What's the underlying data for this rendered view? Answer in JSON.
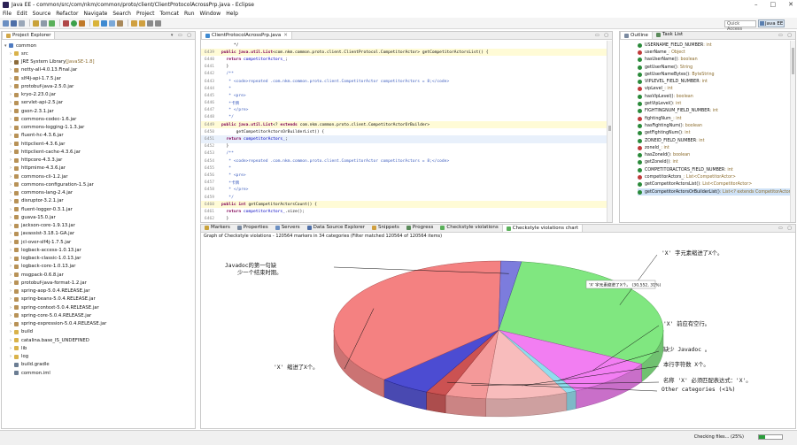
{
  "window": {
    "title": "Java EE - common/src/com/nkm/common/proto/client/ClientProtocolAcrossPrp.java - Eclipse",
    "controls": [
      "–",
      "□",
      "✕"
    ]
  },
  "menu": [
    "File",
    "Edit",
    "Source",
    "Refactor",
    "Navigate",
    "Search",
    "Project",
    "Tomcat",
    "Run",
    "Window",
    "Help"
  ],
  "toolbar": {
    "quick_access_placeholder": "Quick Access",
    "perspective": "Java EE"
  },
  "project_explorer": {
    "tab_label": "Project Explorer",
    "root": "common",
    "items": [
      {
        "label": "src",
        "kind": "folder"
      },
      {
        "label": "JRE System Library",
        "suffix": " [JavaSE-1.8]",
        "kind": "lib"
      },
      {
        "label": "netty-all-4.0.13.Final.jar",
        "kind": "jar"
      },
      {
        "label": "slf4j-api-1.7.5.jar",
        "kind": "jar"
      },
      {
        "label": "protobuf-java-2.5.0.jar",
        "kind": "jar"
      },
      {
        "label": "kryo-2.23.0.jar",
        "kind": "jar"
      },
      {
        "label": "servlet-api-2.5.jar",
        "kind": "jar"
      },
      {
        "label": "gson-2.3.1.jar",
        "kind": "jar"
      },
      {
        "label": "commons-codec-1.6.jar",
        "kind": "jar"
      },
      {
        "label": "commons-logging-1.1.3.jar",
        "kind": "jar"
      },
      {
        "label": "fluent-hc-4.3.6.jar",
        "kind": "jar"
      },
      {
        "label": "httpclient-4.3.6.jar",
        "kind": "jar"
      },
      {
        "label": "httpclient-cache-4.3.6.jar",
        "kind": "jar"
      },
      {
        "label": "httpcore-4.3.3.jar",
        "kind": "jar"
      },
      {
        "label": "httpmime-4.3.6.jar",
        "kind": "jar"
      },
      {
        "label": "commons-cli-1.2.jar",
        "kind": "jar"
      },
      {
        "label": "commons-configuration-1.5.jar",
        "kind": "jar"
      },
      {
        "label": "commons-lang-2.4.jar",
        "kind": "jar"
      },
      {
        "label": "disruptor-3.2.1.jar",
        "kind": "jar"
      },
      {
        "label": "fluent-logger-0.3.1.jar",
        "kind": "jar"
      },
      {
        "label": "guava-15.0.jar",
        "kind": "jar"
      },
      {
        "label": "jackson-core-1.9.13.jar",
        "kind": "jar"
      },
      {
        "label": "javassist-3.18.1-GA.jar",
        "kind": "jar"
      },
      {
        "label": "jcl-over-slf4j-1.7.5.jar",
        "kind": "jar"
      },
      {
        "label": "logback-access-1.0.13.jar",
        "kind": "jar"
      },
      {
        "label": "logback-classic-1.0.13.jar",
        "kind": "jar"
      },
      {
        "label": "logback-core-1.0.13.jar",
        "kind": "jar"
      },
      {
        "label": "msgpack-0.6.8.jar",
        "kind": "jar"
      },
      {
        "label": "protobuf-java-format-1.2.jar",
        "kind": "jar"
      },
      {
        "label": "spring-aop-5.0.4.RELEASE.jar",
        "kind": "jar"
      },
      {
        "label": "spring-beans-5.0.4.RELEASE.jar",
        "kind": "jar"
      },
      {
        "label": "spring-context-5.0.4.RELEASE.jar",
        "kind": "jar"
      },
      {
        "label": "spring-core-5.0.4.RELEASE.jar",
        "kind": "jar"
      },
      {
        "label": "spring-expression-5.0.4.RELEASE.jar",
        "kind": "jar"
      },
      {
        "label": "build",
        "kind": "folder"
      },
      {
        "label": "catalina.base_IS_UNDEFINED",
        "kind": "folder"
      },
      {
        "label": "lib",
        "kind": "folder"
      },
      {
        "label": "log",
        "kind": "folder"
      },
      {
        "label": "build.gradle",
        "kind": "file"
      },
      {
        "label": "common.iml",
        "kind": "file"
      }
    ]
  },
  "editor": {
    "tab_label": "ClientProtocolAcrossPrp.java",
    "lines": [
      {
        "n": "",
        "parts": [
          [
            "",
            "     */"
          ]
        ]
      },
      {
        "n": "6439",
        "hl": true,
        "parts": [
          [
            "kw",
            "public "
          ],
          [
            "kw",
            "java.util.List"
          ],
          [
            "",
            "<com.nkm.common.proto.client.ClientProtocol.CompetitorActor> getCompetitorActorsList() {"
          ]
        ]
      },
      {
        "n": "6440",
        "parts": [
          [
            "kw",
            "  return "
          ],
          [
            "fld",
            "competitorActors_"
          ],
          [
            "",
            ";"
          ]
        ]
      },
      {
        "n": "6441",
        "parts": [
          [
            "",
            "  }"
          ]
        ]
      },
      {
        "n": "6442",
        "parts": [
          [
            "cm",
            "  /**"
          ]
        ]
      },
      {
        "n": "6443",
        "parts": [
          [
            "cm",
            "   * <code>repeated .com.nkm.common.proto.client.CompetitorActor competitorActors = 8;</code>"
          ]
        ]
      },
      {
        "n": "6444",
        "parts": [
          [
            "cm",
            "   *"
          ]
        ]
      },
      {
        "n": "6445",
        "parts": [
          [
            "cm",
            "   * <pre>"
          ]
        ]
      },
      {
        "n": "6446",
        "parts": [
          [
            "cm",
            "   *卡牌"
          ]
        ]
      },
      {
        "n": "6447",
        "parts": [
          [
            "cm",
            "   * </pre>"
          ]
        ]
      },
      {
        "n": "6448",
        "parts": [
          [
            "cm",
            "   */"
          ]
        ]
      },
      {
        "n": "6449",
        "hl": true,
        "parts": [
          [
            "kw",
            "public "
          ],
          [
            "kw",
            "java.util.List"
          ],
          [
            "",
            "<? "
          ],
          [
            "kw",
            "extends "
          ],
          [
            "",
            "com.nkm.common.proto.client.CompetitorActorOrBuilder>"
          ]
        ]
      },
      {
        "n": "6450",
        "parts": [
          [
            "",
            "      getCompetitorActorsOrBuilderList() {"
          ]
        ]
      },
      {
        "n": "6451",
        "cur": true,
        "parts": [
          [
            "kw",
            "  return "
          ],
          [
            "fld",
            "competitorActors_"
          ],
          [
            "",
            ";"
          ]
        ]
      },
      {
        "n": "6452",
        "parts": [
          [
            "",
            "  }"
          ]
        ]
      },
      {
        "n": "6453",
        "parts": [
          [
            "cm",
            "  /**"
          ]
        ]
      },
      {
        "n": "6454",
        "parts": [
          [
            "cm",
            "   * <code>repeated .com.nkm.common.proto.client.CompetitorActor competitorActors = 8;</code>"
          ]
        ]
      },
      {
        "n": "6455",
        "parts": [
          [
            "cm",
            "   *"
          ]
        ]
      },
      {
        "n": "6456",
        "parts": [
          [
            "cm",
            "   * <pre>"
          ]
        ]
      },
      {
        "n": "6457",
        "parts": [
          [
            "cm",
            "   *卡牌"
          ]
        ]
      },
      {
        "n": "6458",
        "parts": [
          [
            "cm",
            "   * </pre>"
          ]
        ]
      },
      {
        "n": "6459",
        "parts": [
          [
            "cm",
            "   */"
          ]
        ]
      },
      {
        "n": "6460",
        "hl": true,
        "parts": [
          [
            "kw",
            "public int "
          ],
          [
            "",
            "getCompetitorActorsCount() {"
          ]
        ]
      },
      {
        "n": "6461",
        "parts": [
          [
            "kw",
            "  return "
          ],
          [
            "fld",
            "competitorActors_"
          ],
          [
            "",
            ".size();"
          ]
        ]
      },
      {
        "n": "6462",
        "parts": [
          [
            "",
            "  }"
          ]
        ]
      }
    ]
  },
  "outline": {
    "tabs": [
      "Outline",
      "Task List"
    ],
    "items": [
      {
        "label": "USERNAME_FIELD_NUMBER",
        "type": " : int",
        "color": "#2a8a3a"
      },
      {
        "label": "userName_",
        "type": " : Object",
        "color": "#c03a3a"
      },
      {
        "label": "hasUserName()",
        "type": " : boolean",
        "color": "#2a8a3a"
      },
      {
        "label": "getUserName()",
        "type": " : String",
        "color": "#2a8a3a"
      },
      {
        "label": "getUserNameBytes()",
        "type": " : ByteString",
        "color": "#2a8a3a"
      },
      {
        "label": "VIPLEVEL_FIELD_NUMBER",
        "type": " : int",
        "color": "#2a8a3a"
      },
      {
        "label": "vipLevel_",
        "type": " : int",
        "color": "#c03a3a"
      },
      {
        "label": "hasVipLevel()",
        "type": " : boolean",
        "color": "#2a8a3a"
      },
      {
        "label": "getVipLevel()",
        "type": " : int",
        "color": "#2a8a3a"
      },
      {
        "label": "FIGHTINGNUM_FIELD_NUMBER",
        "type": " : int",
        "color": "#2a8a3a"
      },
      {
        "label": "fightingNum_",
        "type": " : int",
        "color": "#c03a3a"
      },
      {
        "label": "hasFightingNum()",
        "type": " : boolean",
        "color": "#2a8a3a"
      },
      {
        "label": "getFightingNum()",
        "type": " : int",
        "color": "#2a8a3a"
      },
      {
        "label": "ZONEID_FIELD_NUMBER",
        "type": " : int",
        "color": "#2a8a3a"
      },
      {
        "label": "zoneId_",
        "type": " : int",
        "color": "#c03a3a"
      },
      {
        "label": "hasZoneId()",
        "type": " : boolean",
        "color": "#2a8a3a"
      },
      {
        "label": "getZoneId()",
        "type": " : int",
        "color": "#2a8a3a"
      },
      {
        "label": "COMPETITORACTORS_FIELD_NUMBER",
        "type": " : int",
        "color": "#2a8a3a"
      },
      {
        "label": "competitorActors_",
        "type": " : List<CompetitorActor>",
        "color": "#c03a3a"
      },
      {
        "label": "getCompetitorActorsList()",
        "type": " : List<CompetitorActor>",
        "color": "#2a8a3a"
      },
      {
        "label": "getCompetitorActorsOrBuilderList()",
        "type": " : List<? extends CompetitorActorOrBuild",
        "color": "#2a8a3a",
        "selected": true
      }
    ]
  },
  "bottom": {
    "tabs": [
      "Markers",
      "Properties",
      "Servers",
      "Data Source Explorer",
      "Snippets",
      "Progress",
      "Checkstyle violations",
      "Checkstyle violations chart"
    ],
    "active_tab": 7,
    "subtitle": "Graph of Checkstyle violations - 120564 markers in 34 categories (Filter matched 120564 of 120564 items)"
  },
  "chart_data": {
    "type": "pie",
    "title": "",
    "slices": [
      {
        "label": "'X' 字元素缩进了X个。",
        "value": 30552,
        "percent": 31,
        "color": "#6ee46e"
      },
      {
        "label": "'X' 前应有空行。",
        "value": null,
        "percent": 9,
        "color": "#f06cf0"
      },
      {
        "label": "缺少 Javadoc 。",
        "value": null,
        "percent": 1,
        "color": "#7fd8ec"
      },
      {
        "label": "本行字符数 X个。",
        "value": null,
        "percent": 8,
        "color": "#f7b3b3"
      },
      {
        "label": "名称 'X' 必须匹配表达式：'X'。",
        "value": null,
        "percent": 4,
        "color": "#f28b8b"
      },
      {
        "label": "Other categories (<1%)",
        "value": null,
        "percent": 2,
        "color": "#c43a3a"
      },
      {
        "label": "",
        "value": null,
        "percent": 5,
        "color": "#3333cc"
      },
      {
        "label": "'X' 缩进了X个。",
        "value": null,
        "percent": 38,
        "color": "#f27070"
      },
      {
        "label": "Javadoc的第一句缺少一个结束时期。",
        "value": null,
        "percent": 2,
        "color": "#6a6ad8"
      }
    ],
    "tooltip": "'X' 字元素缩进了X个。 (30,552, 31%)"
  },
  "status": {
    "text": "Checking files... (25%)",
    "progress": 0.25
  }
}
